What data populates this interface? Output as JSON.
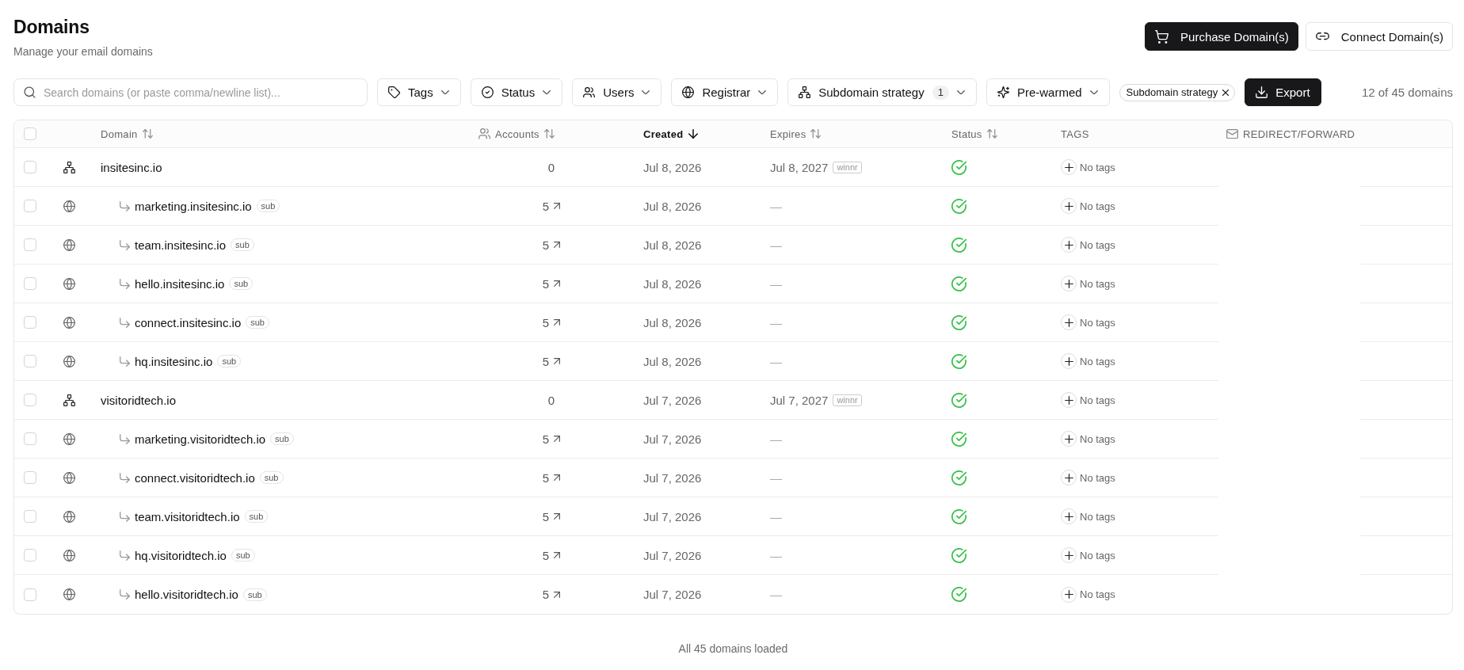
{
  "header": {
    "title": "Domains",
    "subtitle": "Manage your email domains",
    "actions": [
      {
        "kind": "primary",
        "label": "Purchase Domain(s)"
      },
      {
        "kind": "secondary",
        "label": "Connect Domain(s)"
      }
    ]
  },
  "toolbar": {
    "search": {
      "placeholder": "Search domains (or paste comma/newline list)..."
    },
    "filters": [
      {
        "label": "Tags"
      },
      {
        "label": "Status"
      },
      {
        "label": "Users"
      },
      {
        "label": "Registrar"
      },
      {
        "label": "Subdomain strategy",
        "count": "1"
      },
      {
        "label": "Pre-warmed"
      }
    ],
    "active_filters": [
      {
        "label": "Subdomain strategy"
      }
    ],
    "export": {
      "label": "Export"
    },
    "result_count": "12 of 45 domains"
  },
  "table": {
    "select_all": {
      "checked": false
    },
    "columns": [
      {
        "label": "Domain",
        "sorted": false
      },
      {
        "label": "Accounts",
        "sorted": false
      },
      {
        "label": "Created",
        "sorted": true
      },
      {
        "label": "Expires",
        "sorted": false
      },
      {
        "label": "Status",
        "sorted": false
      },
      {
        "label": "TAGS"
      },
      {
        "label": "REDIRECT/FORWARD"
      }
    ],
    "rows": [
      {
        "kind": "root",
        "checked": false,
        "domain": "insitesinc.io",
        "accounts": "0",
        "created": "Jul 8, 2026",
        "expires": "Jul 8, 2027",
        "registrar": "winnr",
        "verified": true,
        "tags_text": "No tags"
      },
      {
        "kind": "sub",
        "checked": false,
        "domain": "marketing.insitesinc.io",
        "badge": "sub",
        "accounts": "5",
        "created": "Jul 8, 2026",
        "expires": "—",
        "verified": true,
        "tags_text": "No tags"
      },
      {
        "kind": "sub",
        "checked": false,
        "domain": "team.insitesinc.io",
        "badge": "sub",
        "accounts": "5",
        "created": "Jul 8, 2026",
        "expires": "—",
        "verified": true,
        "tags_text": "No tags"
      },
      {
        "kind": "sub",
        "checked": false,
        "domain": "hello.insitesinc.io",
        "badge": "sub",
        "accounts": "5",
        "created": "Jul 8, 2026",
        "expires": "—",
        "verified": true,
        "tags_text": "No tags"
      },
      {
        "kind": "sub",
        "checked": false,
        "domain": "connect.insitesinc.io",
        "badge": "sub",
        "accounts": "5",
        "created": "Jul 8, 2026",
        "expires": "—",
        "verified": true,
        "tags_text": "No tags"
      },
      {
        "kind": "sub",
        "checked": false,
        "domain": "hq.insitesinc.io",
        "badge": "sub",
        "accounts": "5",
        "created": "Jul 8, 2026",
        "expires": "—",
        "verified": true,
        "tags_text": "No tags"
      },
      {
        "kind": "root",
        "checked": false,
        "domain": "visitoridtech.io",
        "accounts": "0",
        "created": "Jul 7, 2026",
        "expires": "Jul 7, 2027",
        "registrar": "winnr",
        "verified": true,
        "tags_text": "No tags"
      },
      {
        "kind": "sub",
        "checked": false,
        "domain": "marketing.visitoridtech.io",
        "badge": "sub",
        "accounts": "5",
        "created": "Jul 7, 2026",
        "expires": "—",
        "verified": true,
        "tags_text": "No tags"
      },
      {
        "kind": "sub",
        "checked": false,
        "domain": "connect.visitoridtech.io",
        "badge": "sub",
        "accounts": "5",
        "created": "Jul 7, 2026",
        "expires": "—",
        "verified": true,
        "tags_text": "No tags"
      },
      {
        "kind": "sub",
        "checked": false,
        "domain": "team.visitoridtech.io",
        "badge": "sub",
        "accounts": "5",
        "created": "Jul 7, 2026",
        "expires": "—",
        "verified": true,
        "tags_text": "No tags"
      },
      {
        "kind": "sub",
        "checked": false,
        "domain": "hq.visitoridtech.io",
        "badge": "sub",
        "accounts": "5",
        "created": "Jul 7, 2026",
        "expires": "—",
        "verified": true,
        "tags_text": "No tags"
      },
      {
        "kind": "sub",
        "checked": false,
        "domain": "hello.visitoridtech.io",
        "badge": "sub",
        "accounts": "5",
        "created": "Jul 7, 2026",
        "expires": "—",
        "verified": true,
        "tags_text": "No tags"
      }
    ]
  },
  "footer": {
    "status": "All 45 domains loaded"
  }
}
